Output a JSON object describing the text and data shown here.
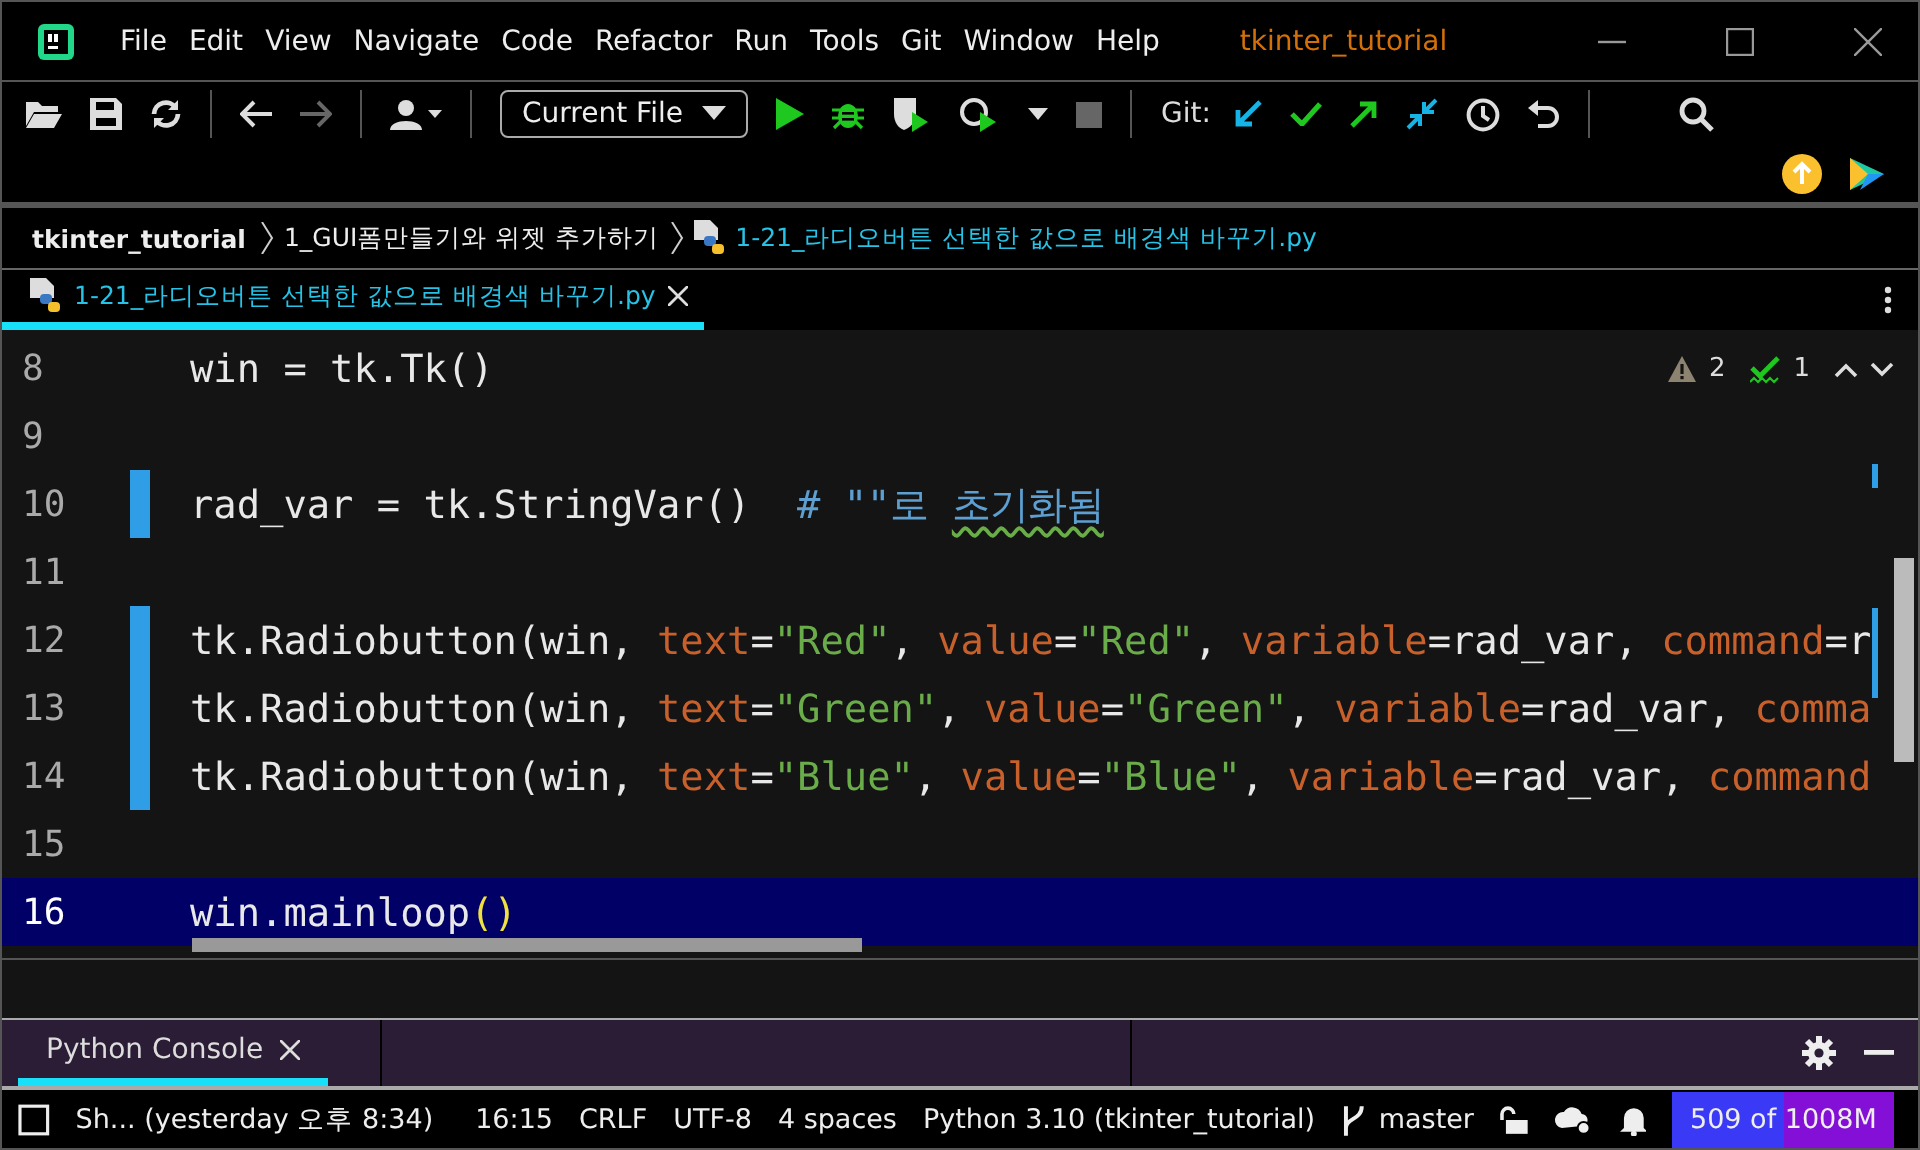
{
  "window": {
    "title": "tkinter_tutorial"
  },
  "menu": [
    "File",
    "Edit",
    "View",
    "Navigate",
    "Code",
    "Refactor",
    "Run",
    "Tools",
    "Git",
    "Window",
    "Help"
  ],
  "toolbar": {
    "run_config": "Current File",
    "git_label": "Git:"
  },
  "breadcrumb": [
    "tkinter_tutorial",
    "1_GUI폼만들기와 위젯 추가하기",
    "1-21_라디오버튼 선택한 값으로 배경색 바꾸기.py"
  ],
  "editor_tabs": [
    {
      "label": "1-21_라디오버튼 선택한 값으로 배경색 바꾸기.py",
      "selected": true
    }
  ],
  "inspections": {
    "warnings": "2",
    "typos": "1"
  },
  "lines": [
    {
      "number": "8",
      "changed": false,
      "current": false,
      "tokens": [
        {
          "kind": "plain",
          "text": "win = tk.Tk()"
        }
      ]
    },
    {
      "number": "9",
      "changed": false,
      "current": false
    },
    {
      "number": "10",
      "changed": true,
      "current": false,
      "tokens": [
        {
          "kind": "plain",
          "text": "rad_var = tk.StringVar()  "
        },
        {
          "kind": "comment",
          "text": "# \"\"로 "
        },
        {
          "kind": "typo",
          "text": "초기화됨"
        }
      ]
    },
    {
      "number": "11",
      "changed": false,
      "current": false
    },
    {
      "number": "12",
      "changed": true,
      "current": false,
      "tokens": [
        {
          "kind": "plain",
          "text": "tk.Radiobutton(win, "
        },
        {
          "kind": "param",
          "text": "text"
        },
        {
          "kind": "plain",
          "text": "="
        },
        {
          "kind": "string",
          "text": "\"Red\""
        },
        {
          "kind": "plain",
          "text": ", "
        },
        {
          "kind": "param",
          "text": "value"
        },
        {
          "kind": "plain",
          "text": "="
        },
        {
          "kind": "string",
          "text": "\"Red\""
        },
        {
          "kind": "plain",
          "text": ", "
        },
        {
          "kind": "param",
          "text": "variable"
        },
        {
          "kind": "plain",
          "text": "=rad_var, "
        },
        {
          "kind": "param",
          "text": "command"
        },
        {
          "kind": "plain",
          "text": "=r"
        }
      ]
    },
    {
      "number": "13",
      "changed": true,
      "current": false,
      "tokens": [
        {
          "kind": "plain",
          "text": "tk.Radiobutton(win, "
        },
        {
          "kind": "param",
          "text": "text"
        },
        {
          "kind": "plain",
          "text": "="
        },
        {
          "kind": "string",
          "text": "\"Green\""
        },
        {
          "kind": "plain",
          "text": ", "
        },
        {
          "kind": "param",
          "text": "value"
        },
        {
          "kind": "plain",
          "text": "="
        },
        {
          "kind": "string",
          "text": "\"Green\""
        },
        {
          "kind": "plain",
          "text": ", "
        },
        {
          "kind": "param",
          "text": "variable"
        },
        {
          "kind": "plain",
          "text": "=rad_var, "
        },
        {
          "kind": "param",
          "text": "comma"
        }
      ]
    },
    {
      "number": "14",
      "changed": true,
      "current": false,
      "tokens": [
        {
          "kind": "plain",
          "text": "tk.Radiobutton(win, "
        },
        {
          "kind": "param",
          "text": "text"
        },
        {
          "kind": "plain",
          "text": "="
        },
        {
          "kind": "string",
          "text": "\"Blue\""
        },
        {
          "kind": "plain",
          "text": ", "
        },
        {
          "kind": "param",
          "text": "value"
        },
        {
          "kind": "plain",
          "text": "="
        },
        {
          "kind": "string",
          "text": "\"Blue\""
        },
        {
          "kind": "plain",
          "text": ", "
        },
        {
          "kind": "param",
          "text": "variable"
        },
        {
          "kind": "plain",
          "text": "=rad_var, "
        },
        {
          "kind": "param",
          "text": "command"
        }
      ]
    },
    {
      "number": "15",
      "changed": false,
      "current": false
    },
    {
      "number": "16",
      "changed": false,
      "current": true,
      "tokens": [
        {
          "kind": "plain",
          "text": "win.mainloop"
        },
        {
          "kind": "brace",
          "text": "()"
        }
      ]
    }
  ],
  "tool_tabs": [
    {
      "label": "Python Console",
      "selected": true
    }
  ],
  "status_bar": {
    "vcs_message": "Sh... (yesterday 오후 8:34)",
    "position": "16:15",
    "line_separator": "CRLF",
    "encoding": "UTF-8",
    "indent": "4 spaces",
    "interpreter": "Python 3.10 (tkinter_tutorial)",
    "branch": "master",
    "memory": {
      "text": "509 of 1008M",
      "level": 0.505
    }
  }
}
